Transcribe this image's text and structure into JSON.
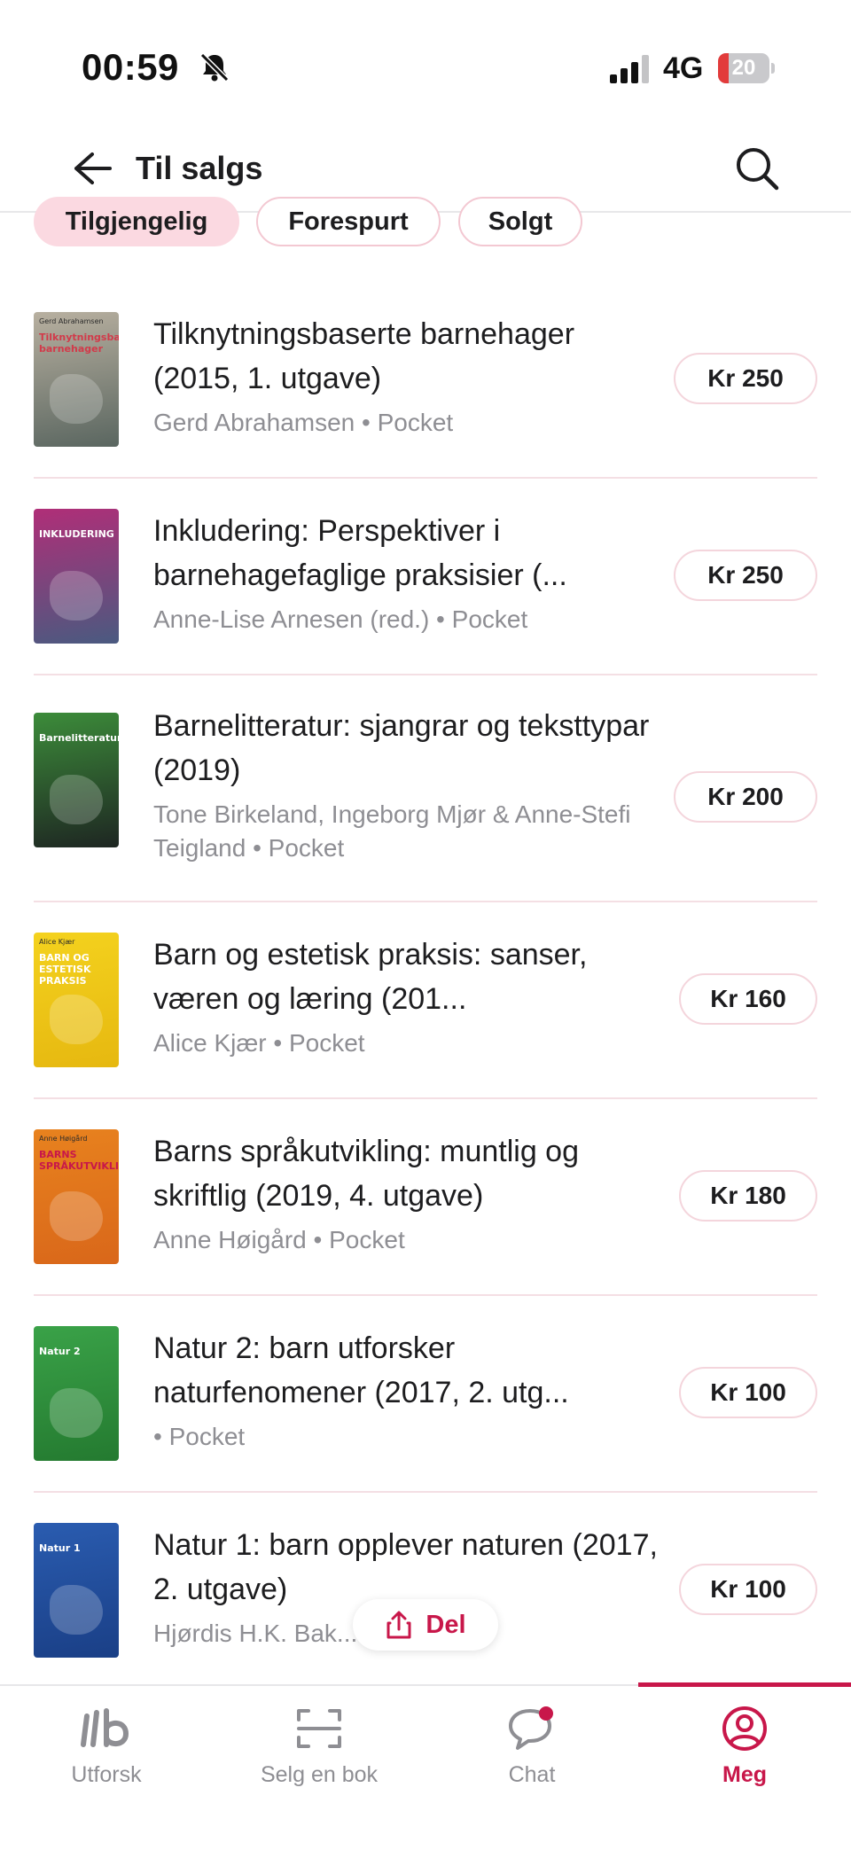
{
  "status_bar": {
    "time": "00:59",
    "network": "4G",
    "battery_level": "20",
    "battery_fraction": 0.2
  },
  "header": {
    "title": "Til salgs"
  },
  "filters": {
    "tabs": [
      {
        "label": "Tilgjengelig",
        "active": true
      },
      {
        "label": "Forespurt",
        "active": false
      },
      {
        "label": "Solgt",
        "active": false
      }
    ]
  },
  "books": [
    {
      "title": "Tilknytningsbaserte barnehager (2015, 1. utgave)",
      "meta": "Gerd Abrahamsen • Pocket",
      "price": "Kr 250",
      "cover": {
        "colors": [
          "#b8b0a0",
          "#5a6660"
        ],
        "text": "Tilknytningsbaserte barnehager",
        "author": "Gerd Abrahamsen",
        "text_color": "#d23a4a"
      }
    },
    {
      "title": "Inkludering: Perspektiver i barnehagefaglige praksisier (...",
      "meta": "Anne-Lise Arnesen (red.) • Pocket",
      "price": "Kr 250",
      "cover": {
        "colors": [
          "#b02e78",
          "#4a5a80"
        ],
        "text": "INKLUDERING",
        "author": "",
        "text_color": "#ffffff"
      }
    },
    {
      "title": "Barnelitteratur: sjangrar og teksttypar (2019)",
      "meta": "Tone Birkeland, Ingeborg Mjør & Anne-Stefi Teigland • Pocket",
      "price": "Kr 200",
      "cover": {
        "colors": [
          "#3c8c3a",
          "#1e2622"
        ],
        "text": "Barnelitteratur",
        "author": "",
        "text_color": "#ffffff"
      }
    },
    {
      "title": "Barn og estetisk praksis: sanser, væren og læring (201...",
      "meta": "Alice Kjær • Pocket",
      "price": "Kr 160",
      "cover": {
        "colors": [
          "#f4d21e",
          "#e6b810"
        ],
        "text": "BARN OG ESTETISK PRAKSIS",
        "author": "Alice Kjær",
        "text_color": "#ffffff"
      }
    },
    {
      "title": "Barns språkutvikling: muntlig og skriftlig (2019, 4. utgave)",
      "meta": "Anne Høigård • Pocket",
      "price": "Kr 180",
      "cover": {
        "colors": [
          "#e8821e",
          "#d9671a"
        ],
        "text": "BARNS SPRÅKUTVIKLING",
        "author": "Anne Høigård",
        "text_color": "#c8174a"
      }
    },
    {
      "title": "Natur 2: barn utforsker naturfenomener (2017, 2. utg...",
      "meta": " • Pocket",
      "price": "Kr 100",
      "cover": {
        "colors": [
          "#3aa248",
          "#247a30"
        ],
        "text": "Natur 2",
        "author": "",
        "text_color": "#ffffff"
      }
    },
    {
      "title": "Natur 1: barn opplever naturen (2017, 2. utgave)",
      "meta": "Hjørdis H.K. Bak... • Pocket",
      "price": "Kr 100",
      "cover": {
        "colors": [
          "#2a5cb0",
          "#1a3f86"
        ],
        "text": "Natur 1",
        "author": "",
        "text_color": "#ffffff"
      }
    }
  ],
  "share": {
    "label": "Del"
  },
  "bottom_nav": {
    "items": [
      {
        "label": "Utforsk",
        "icon": "bookis-logo-icon",
        "active": false
      },
      {
        "label": "Selg en bok",
        "icon": "scan-icon",
        "active": false
      },
      {
        "label": "Chat",
        "icon": "chat-icon",
        "active": false,
        "badge": true
      },
      {
        "label": "Meg",
        "icon": "profile-icon",
        "active": true
      }
    ]
  },
  "colors": {
    "accent": "#c8174a",
    "tab_active_bg": "#fbd9e1",
    "muted_text": "#8e8e93"
  }
}
